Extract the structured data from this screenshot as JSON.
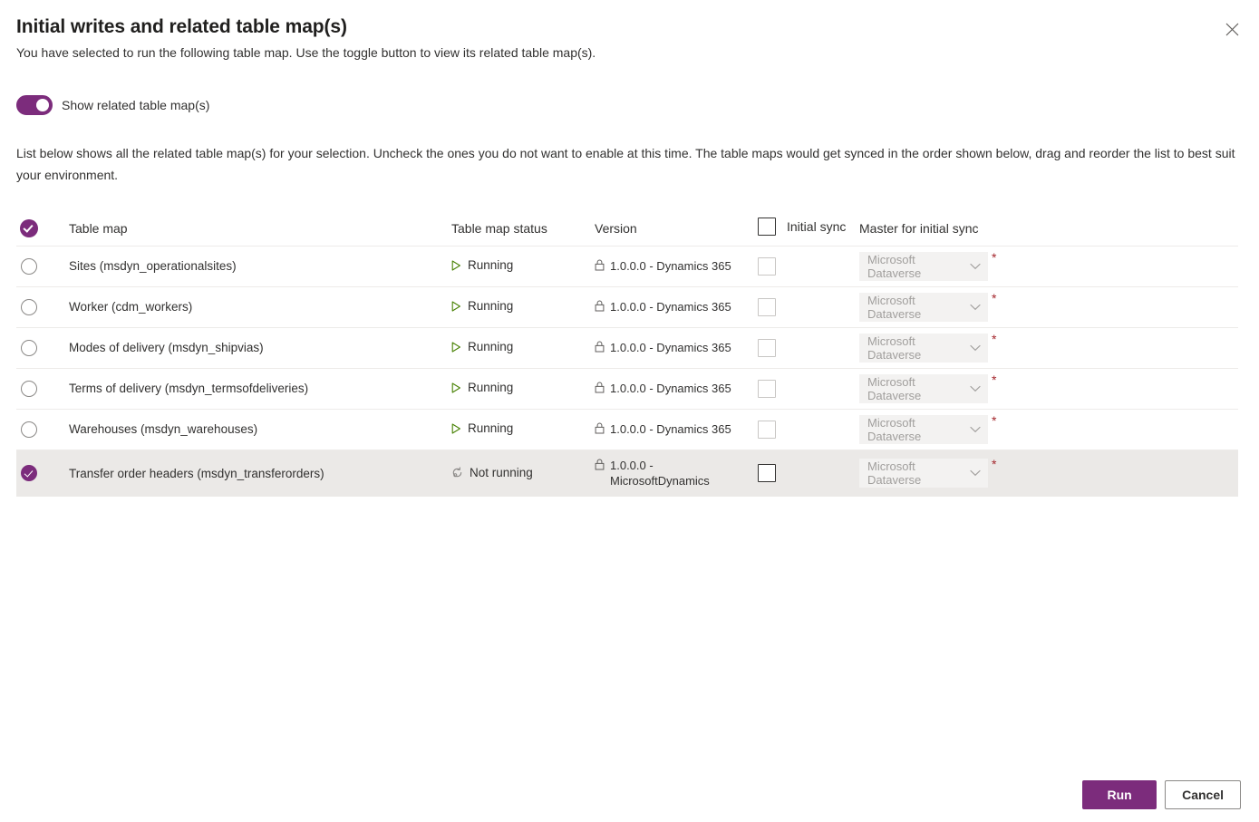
{
  "dialog": {
    "title": "Initial writes and related table map(s)",
    "subtitle": "You have selected to run the following table map. Use the toggle button to view its related table map(s).",
    "close_label": "Close"
  },
  "toggle": {
    "label": "Show related table map(s)",
    "state": "on",
    "accent_color": "#7c2c7c"
  },
  "intro": "List below shows all the related table map(s) for your selection. Uncheck the ones you do not want to enable at this time. The table maps would get synced in the order shown below, drag and reorder the list to best suit your environment.",
  "table": {
    "headers": {
      "select_all": "select-all-checkmark",
      "table_map": "Table map",
      "table_map_status": "Table map status",
      "version": "Version",
      "initial_sync": "Initial sync",
      "master_for_initial_sync": "Master for initial sync"
    },
    "rows": [
      {
        "selected": false,
        "name": "Sites (msdyn_operationalsites)",
        "status": "Running",
        "status_icon": "play-icon",
        "version": "1.0.0.0 - Dynamics 365",
        "initial_sync_checked": false,
        "master": "Microsoft Dataverse",
        "required": "*"
      },
      {
        "selected": false,
        "name": "Worker (cdm_workers)",
        "status": "Running",
        "status_icon": "play-icon",
        "version": "1.0.0.0 - Dynamics 365",
        "initial_sync_checked": false,
        "master": "Microsoft Dataverse",
        "required": "*"
      },
      {
        "selected": false,
        "name": "Modes of delivery (msdyn_shipvias)",
        "status": "Running",
        "status_icon": "play-icon",
        "version": "1.0.0.0 - Dynamics 365",
        "initial_sync_checked": false,
        "master": "Microsoft Dataverse",
        "required": "*"
      },
      {
        "selected": false,
        "name": "Terms of delivery (msdyn_termsofdeliveries)",
        "status": "Running",
        "status_icon": "play-icon",
        "version": "1.0.0.0 - Dynamics 365",
        "initial_sync_checked": false,
        "master": "Microsoft Dataverse",
        "required": "*"
      },
      {
        "selected": false,
        "name": "Warehouses (msdyn_warehouses)",
        "status": "Running",
        "status_icon": "play-icon",
        "version": "1.0.0.0 - Dynamics 365",
        "initial_sync_checked": false,
        "master": "Microsoft Dataverse",
        "required": "*"
      },
      {
        "selected": true,
        "name": "Transfer order headers (msdyn_transferorders)",
        "status": "Not running",
        "status_icon": "refresh-off-icon",
        "version": "1.0.0.0 - MicrosoftDynamics",
        "initial_sync_checked": false,
        "master": "Microsoft Dataverse",
        "required": "*"
      }
    ]
  },
  "footer": {
    "run_label": "Run",
    "cancel_label": "Cancel"
  },
  "colors": {
    "accent": "#7c2c7c",
    "running_green": "#498205",
    "required_red": "#a4262c",
    "selected_row_bg": "#ebe9e7"
  }
}
